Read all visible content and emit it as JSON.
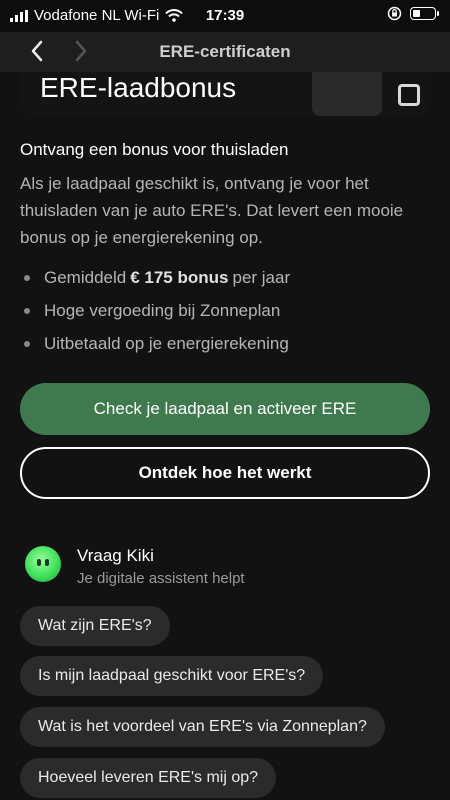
{
  "status_bar": {
    "carrier": "Vodafone NL Wi-Fi",
    "time": "17:39",
    "icons": [
      "signal-bars-icon",
      "wifi-icon",
      "orientation-lock-icon",
      "battery-icon"
    ]
  },
  "nav": {
    "title": "ERE-certificaten",
    "back_icon": "chevron-left-icon",
    "forward_icon": "chevron-right-icon"
  },
  "hero": {
    "heading": "ERE-laadbonus"
  },
  "content": {
    "subtitle": "Ontvang een bonus voor thuisladen",
    "description": "Als je laadpaal geschikt is, ontvang je voor het thuisladen van je auto ERE's. Dat levert een mooie bonus op je energierekening op.",
    "bullets": [
      {
        "pre": "Gemiddeld",
        "bold": "€ 175 bonus",
        "post": "per jaar"
      },
      {
        "text": "Hoge vergoeding bij Zonneplan"
      },
      {
        "text": "Uitbetaald op je energierekening"
      }
    ]
  },
  "buttons": {
    "primary": "Check je laadpaal en activeer ERE",
    "secondary": "Ontdek hoe het werkt"
  },
  "assistant": {
    "name": "Vraag Kiki",
    "tagline": "Je digitale assistent helpt",
    "questions": [
      "Wat zijn ERE's?",
      "Is mijn laadpaal geschikt voor ERE's?",
      "Wat is het voordeel van ERE's via Zonneplan?",
      "Hoeveel leveren ERE's mij op?"
    ]
  },
  "colors": {
    "background": "#121212",
    "primary_button": "#3f7a4e",
    "chip": "#2b2b2b",
    "kiki_avatar": "#3fe05a"
  }
}
